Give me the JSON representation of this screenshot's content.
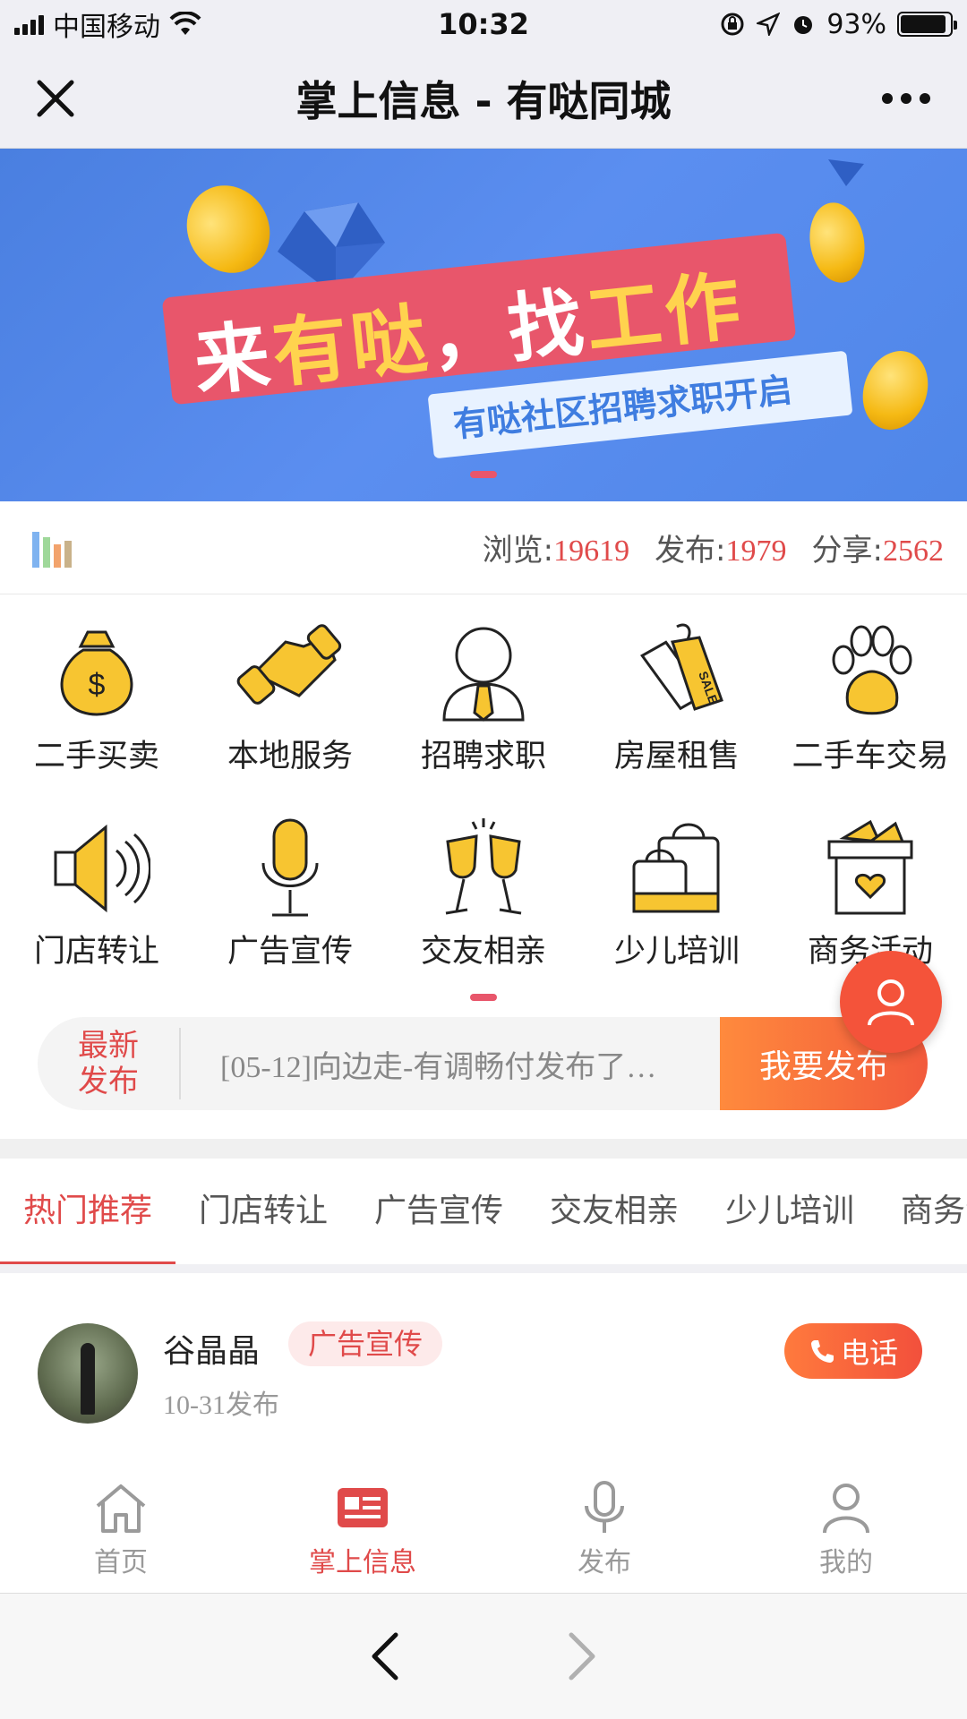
{
  "status": {
    "carrier": "中国移动",
    "time": "10:32",
    "battery": "93%",
    "battery_level": 0.93
  },
  "nav": {
    "title": "掌上信息 - 有哒同城"
  },
  "banner": {
    "headline_a": "来",
    "headline_b": "有哒",
    "headline_c": "，找",
    "headline_d": "工作",
    "subline": "有哒社区招聘求职开启"
  },
  "stats": {
    "views_label": "浏览:",
    "views": "19619",
    "posts_label": "发布:",
    "posts": "1979",
    "shares_label": "分享:",
    "shares": "2562"
  },
  "categories": [
    {
      "label": "二手买卖",
      "icon": "money-bag-icon"
    },
    {
      "label": "本地服务",
      "icon": "handshake-icon"
    },
    {
      "label": "招聘求职",
      "icon": "person-tie-icon"
    },
    {
      "label": "房屋租售",
      "icon": "sale-tag-icon"
    },
    {
      "label": "二手车交易",
      "icon": "paw-icon"
    },
    {
      "label": "门店转让",
      "icon": "speaker-icon"
    },
    {
      "label": "广告宣传",
      "icon": "microphone-icon"
    },
    {
      "label": "交友相亲",
      "icon": "cheers-icon"
    },
    {
      "label": "少儿培训",
      "icon": "shopping-bag-icon"
    },
    {
      "label": "商务活动",
      "icon": "gift-basket-icon"
    }
  ],
  "latest": {
    "tag": "最新发布",
    "text": "[05-12]向边走-有调畅付发布了…",
    "publish_button": "我要发布"
  },
  "tabs": [
    "热门推荐",
    "门店转让",
    "广告宣传",
    "交友相亲",
    "少儿培训",
    "商务活动"
  ],
  "post": {
    "name": "谷晶晶",
    "tag": "广告宣传",
    "date": "10-31发布",
    "call_label": "电话"
  },
  "tabbar": [
    {
      "label": "首页",
      "icon": "home-icon"
    },
    {
      "label": "掌上信息",
      "icon": "news-icon",
      "active": true
    },
    {
      "label": "发布",
      "icon": "microphone-icon"
    },
    {
      "label": "我的",
      "icon": "user-icon"
    }
  ],
  "colors": {
    "accent": "#e04a4a",
    "orange": "#f25a3c",
    "icon_yellow": "#f7c531",
    "banner_blue": "#4f86e8"
  }
}
